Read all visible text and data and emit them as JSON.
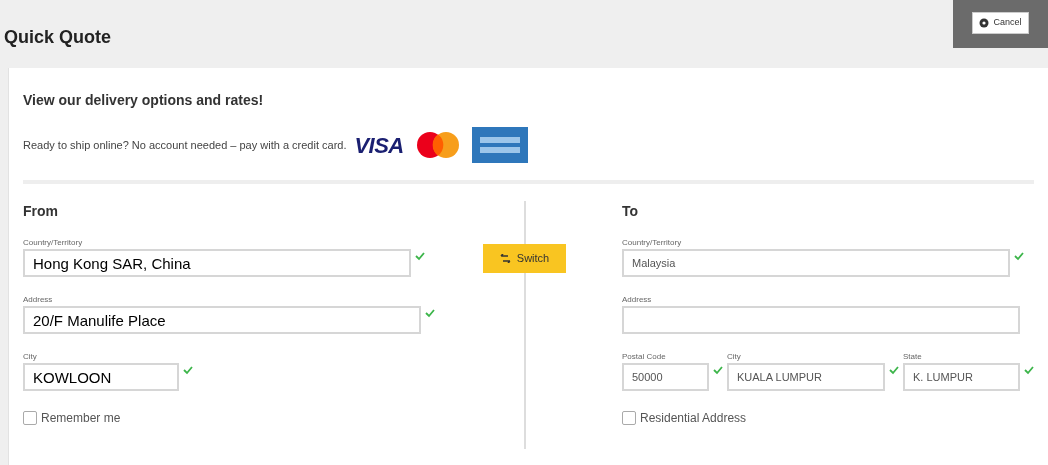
{
  "header": {
    "title": "Quick Quote",
    "cancel_button": "Cancel"
  },
  "intro": {
    "heading": "View our delivery options and rates!",
    "note": "Ready to ship online? No account needed – pay with a credit card.",
    "visa_logo": "VISA"
  },
  "from": {
    "heading": "From",
    "rows": [
      [
        {
          "label": "Country/Territory",
          "value": "Hong Kong SAR, China",
          "valid": true
        }
      ],
      [
        {
          "label": "Address",
          "value": "20/F Manulife Place",
          "valid": true
        }
      ],
      [
        {
          "label": "City",
          "value": "KOWLOON",
          "valid": true
        }
      ]
    ],
    "checkbox": {
      "label": "Remember me",
      "checked": false
    }
  },
  "switch_button": "Switch",
  "to": {
    "heading": "To",
    "rows": [
      [
        {
          "label": "Country/Territory",
          "value": "Malaysia",
          "valid": true
        }
      ],
      [
        {
          "label": "Address",
          "valid": false
        }
      ],
      [
        {
          "label": "Postal Code",
          "value": "50000",
          "valid": true
        },
        {
          "label": "City",
          "value": "KUALA LUMPUR",
          "valid": true
        },
        {
          "label": "State",
          "value": "K. LUMPUR",
          "valid": true
        }
      ]
    ],
    "checkbox": {
      "label": "Residential Address",
      "checked": false
    }
  }
}
